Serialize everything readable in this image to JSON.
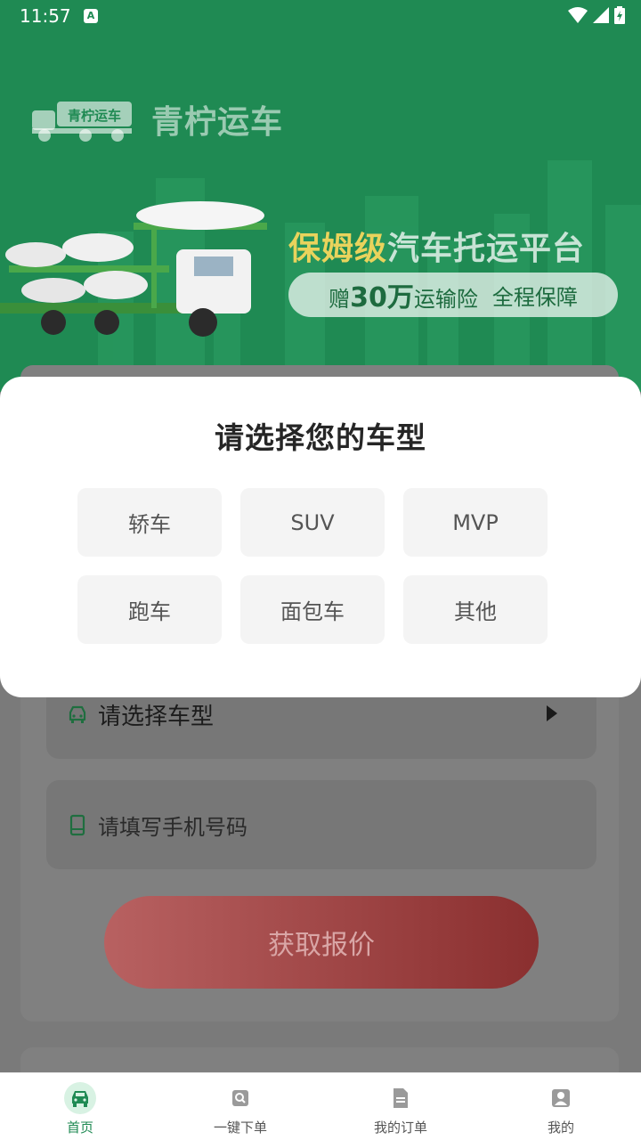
{
  "status_bar": {
    "time": "11:57",
    "notification_badge": "A"
  },
  "banner": {
    "logo_badge": "青柠运车",
    "logo_text": "青柠运车",
    "slogan_part1": "保姆级",
    "slogan_part2": "汽车托运平台",
    "pill_prefix": "赠",
    "pill_amount": "30万",
    "pill_middle": "运输险",
    "pill_suffix": "全程保障",
    "colors": {
      "background": "#1f8a53",
      "slogan_accent": "#e9d35c"
    }
  },
  "form": {
    "car_type_placeholder": "请选择车型",
    "phone_placeholder": "请填写手机号码",
    "quote_button": "获取报价"
  },
  "modal": {
    "title": "请选择您的车型",
    "options": [
      "轿车",
      "SUV",
      "MVP",
      "跑车",
      "面包车",
      "其他"
    ]
  },
  "bottom_nav": {
    "items": [
      {
        "label": "首页",
        "icon": "car-icon",
        "active": true
      },
      {
        "label": "一键下单",
        "icon": "order-icon",
        "active": false
      },
      {
        "label": "我的订单",
        "icon": "document-icon",
        "active": false
      },
      {
        "label": "我的",
        "icon": "person-icon",
        "active": false
      }
    ],
    "active_color": "#1f8a53"
  }
}
